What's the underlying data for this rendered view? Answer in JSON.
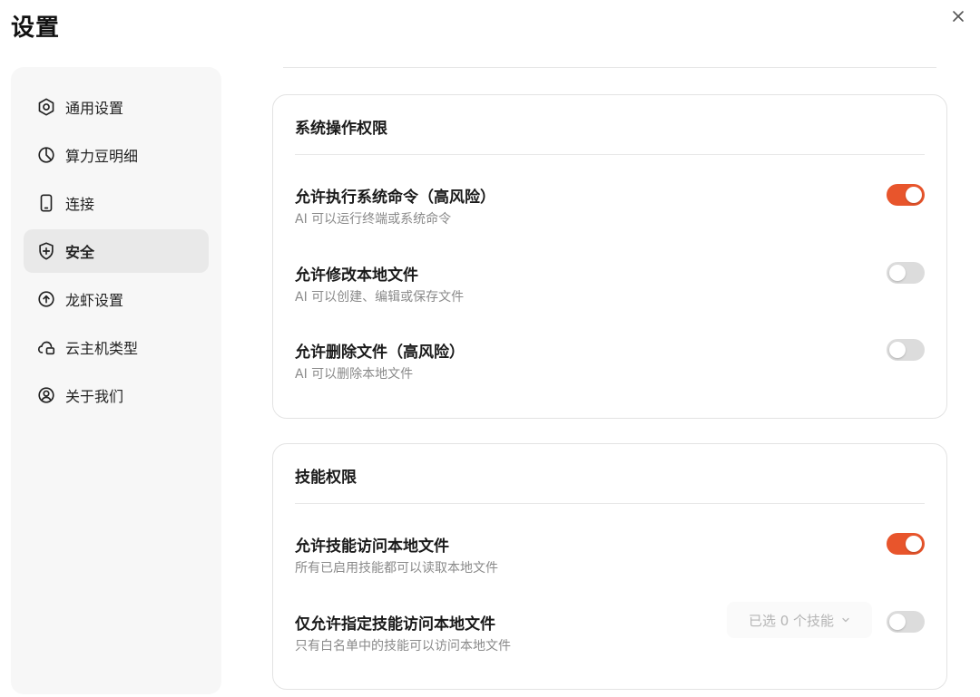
{
  "window": {
    "title": "设置"
  },
  "sidebar": {
    "items": [
      {
        "label": "通用设置",
        "icon": "settings-icon"
      },
      {
        "label": "算力豆明细",
        "icon": "pie-chart-icon"
      },
      {
        "label": "连接",
        "icon": "phone-icon"
      },
      {
        "label": "安全",
        "icon": "shield-icon",
        "active": true
      },
      {
        "label": "龙虾设置",
        "icon": "upload-circle-icon"
      },
      {
        "label": "云主机类型",
        "icon": "cloud-host-icon"
      },
      {
        "label": "关于我们",
        "icon": "user-circle-icon"
      }
    ]
  },
  "sections": {
    "system": {
      "title": "系统操作权限",
      "rows": [
        {
          "title": "允许执行系统命令（高风险）",
          "desc": "AI 可以运行终端或系统命令",
          "enabled": true
        },
        {
          "title": "允许修改本地文件",
          "desc": "AI 可以创建、编辑或保存文件",
          "enabled": false
        },
        {
          "title": "允许删除文件（高风险）",
          "desc": "AI 可以删除本地文件",
          "enabled": false
        }
      ]
    },
    "skills": {
      "title": "技能权限",
      "rows": [
        {
          "title": "允许技能访问本地文件",
          "desc": "所有已启用技能都可以读取本地文件",
          "enabled": true
        },
        {
          "title": "仅允许指定技能访问本地文件",
          "desc": "只有白名单中的技能可以访问本地文件",
          "enabled": false,
          "select_label": "已选 0 个技能"
        }
      ]
    }
  },
  "colors": {
    "accent": "#e8552c",
    "toggle_off": "#dcdcdc"
  }
}
